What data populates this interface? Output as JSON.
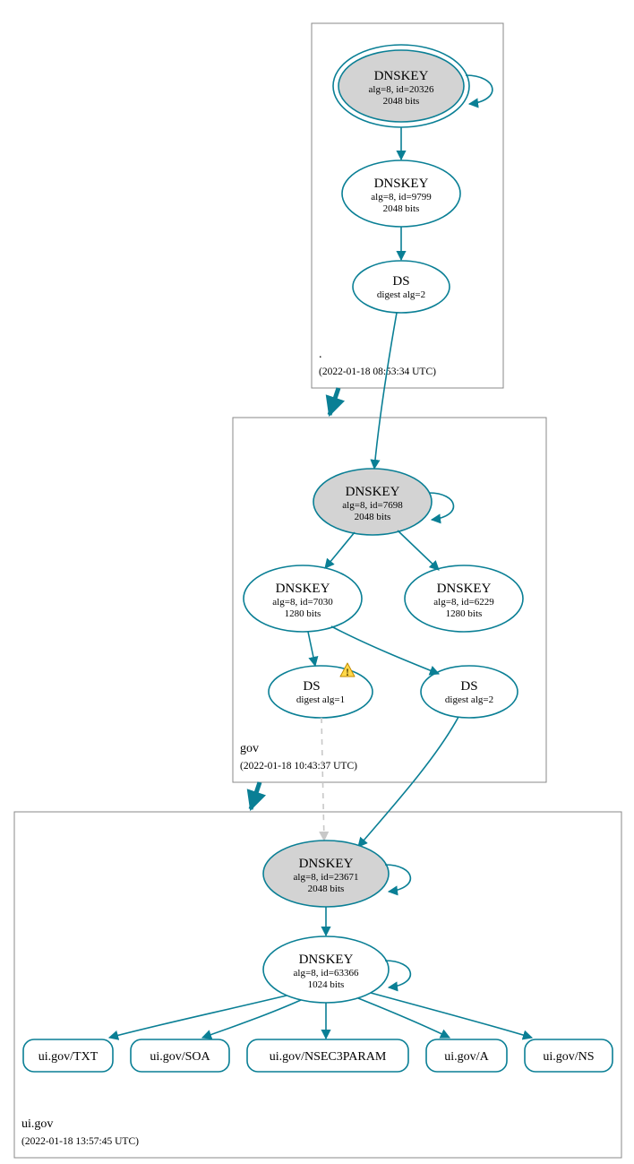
{
  "zones": {
    "root": {
      "label": ".",
      "timestamp": "(2022-01-18 08:53:34 UTC)"
    },
    "gov": {
      "label": "gov",
      "timestamp": "(2022-01-18 10:43:37 UTC)"
    },
    "uigov": {
      "label": "ui.gov",
      "timestamp": "(2022-01-18 13:57:45 UTC)"
    }
  },
  "nodes": {
    "root_ksk": {
      "title": "DNSKEY",
      "line2": "alg=8, id=20326",
      "line3": "2048 bits"
    },
    "root_zsk": {
      "title": "DNSKEY",
      "line2": "alg=8, id=9799",
      "line3": "2048 bits"
    },
    "root_ds": {
      "title": "DS",
      "line2": "digest alg=2"
    },
    "gov_ksk": {
      "title": "DNSKEY",
      "line2": "alg=8, id=7698",
      "line3": "2048 bits"
    },
    "gov_zsk1": {
      "title": "DNSKEY",
      "line2": "alg=8, id=7030",
      "line3": "1280 bits"
    },
    "gov_zsk2": {
      "title": "DNSKEY",
      "line2": "alg=8, id=6229",
      "line3": "1280 bits"
    },
    "gov_ds1": {
      "title": "DS",
      "line2": "digest alg=1"
    },
    "gov_ds2": {
      "title": "DS",
      "line2": "digest alg=2"
    },
    "uigov_ksk": {
      "title": "DNSKEY",
      "line2": "alg=8, id=23671",
      "line3": "2048 bits"
    },
    "uigov_zsk": {
      "title": "DNSKEY",
      "line2": "alg=8, id=63366",
      "line3": "1024 bits"
    },
    "rec_txt": {
      "label": "ui.gov/TXT"
    },
    "rec_soa": {
      "label": "ui.gov/SOA"
    },
    "rec_nsec3": {
      "label": "ui.gov/NSEC3PARAM"
    },
    "rec_a": {
      "label": "ui.gov/A"
    },
    "rec_ns": {
      "label": "ui.gov/NS"
    }
  },
  "colors": {
    "stroke": "#0a7f95",
    "node_grey": "#d3d3d3",
    "box": "#888888",
    "dash": "#c8c8c8"
  }
}
